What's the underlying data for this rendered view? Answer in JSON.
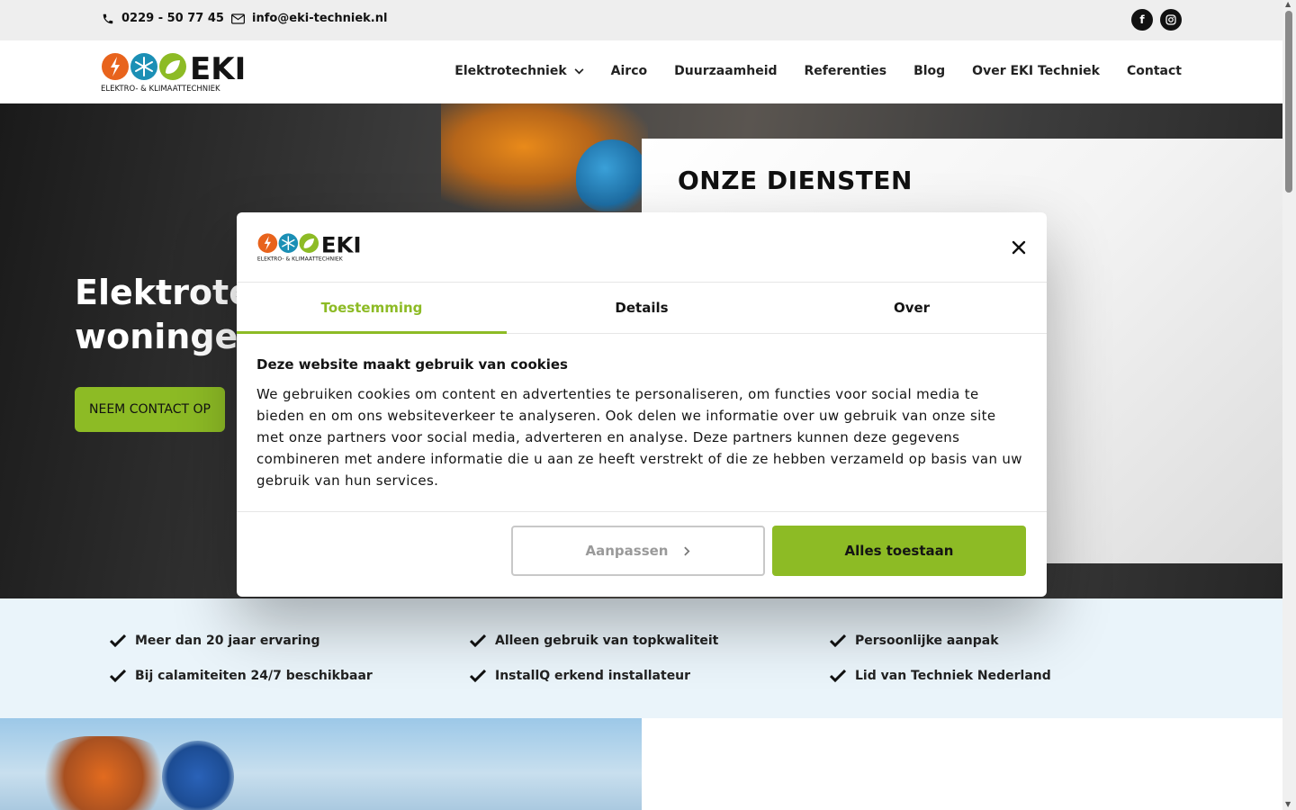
{
  "topbar": {
    "phone": "0229 - 50 77 45",
    "email": "info@eki-techniek.nl",
    "social": [
      {
        "icon": "facebook-icon",
        "glyph": "f"
      },
      {
        "icon": "instagram-icon",
        "glyph": "◎"
      }
    ]
  },
  "logo": {
    "brand": "EKI",
    "tagline": "ELEKTRO- & KLIMAATTECHNIEK"
  },
  "nav": {
    "items": [
      "Elektrotechniek",
      "Airco",
      "Duurzaamheid",
      "Referenties",
      "Blog",
      "Over EKI Techniek",
      "Contact"
    ]
  },
  "hero": {
    "title_line1": "Elektrotec",
    "title_line2": "woningen,",
    "button": "NEEM CONTACT OP",
    "services_title": "ONZE DIENSTEN"
  },
  "features": [
    "Meer dan 20 jaar ervaring",
    "Alleen gebruik van topkwaliteit",
    "Persoonlijke aanpak",
    "Bij calamiteiten 24/7 beschikbaar",
    "InstallQ erkend installateur",
    "Lid van Techniek Nederland"
  ],
  "cookie": {
    "logo_brand": "EKI",
    "logo_tagline": "ELEKTRO- & KLIMAATTECHNIEK",
    "tabs": [
      "Toestemming",
      "Details",
      "Over"
    ],
    "active_tab": "Toestemming",
    "heading": "Deze website maakt gebruik van cookies",
    "body": "We gebruiken cookies om content en advertenties te personaliseren, om functies voor social media te bieden en om ons websiteverkeer te analyseren. Ook delen we informatie over uw gebruik van onze site met onze partners voor social media, adverteren en analyse. Deze partners kunnen deze gegevens combineren met andere informatie die u aan ze heeft verstrekt of die ze hebben verzameld op basis van uw gebruik van hun services.",
    "customize_label": "Aanpassen",
    "allow_label": "Alles toestaan"
  },
  "colors": {
    "accent": "#8dbb25",
    "feature_bg": "#eaf4fa",
    "topbar_bg": "#eeeeee"
  }
}
